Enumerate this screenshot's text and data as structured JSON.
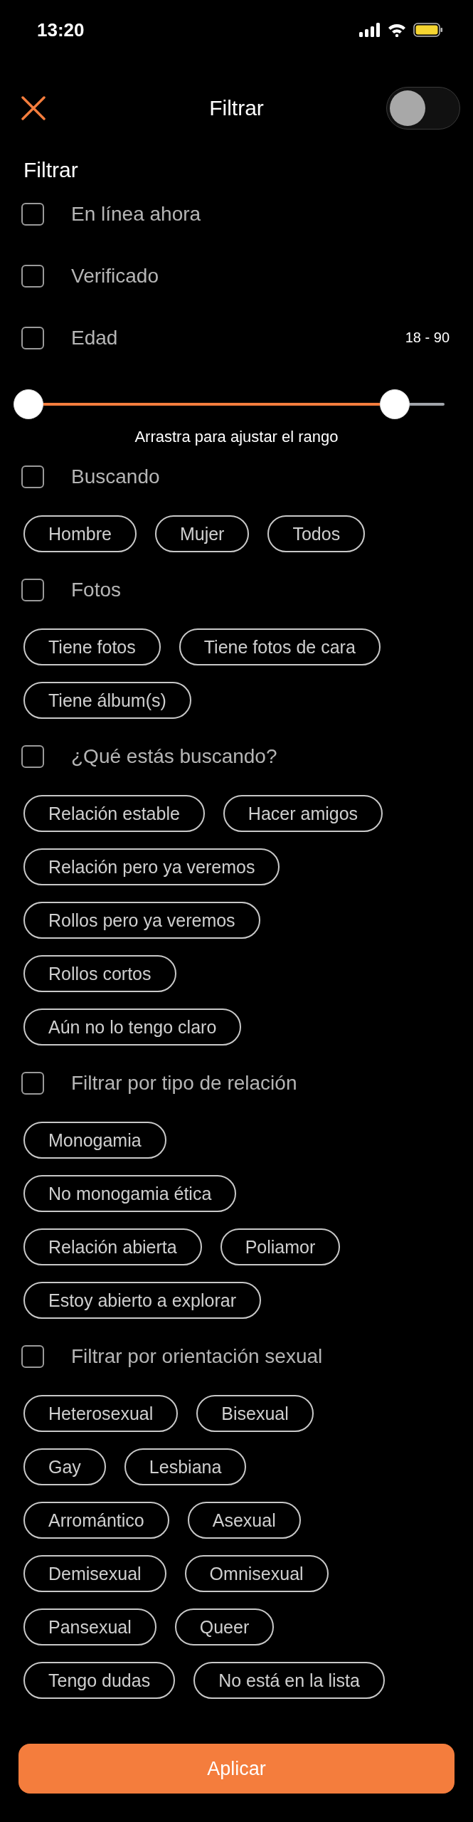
{
  "status_bar": {
    "time": "13:20"
  },
  "header": {
    "title": "Filtrar",
    "toggle_on": false
  },
  "section_title": "Filtrar",
  "groups": [
    {
      "label": "En línea ahora",
      "checked": false
    },
    {
      "label": "Verificado",
      "checked": false
    },
    {
      "label": "Edad",
      "checked": false,
      "value": "18 - 90",
      "slider": {
        "thumbs": [
          {
            "level": 0
          },
          {
            "level": 0.88
          }
        ],
        "hint": "Arrastra para ajustar el rango"
      }
    },
    {
      "label": "Buscando",
      "checked": false,
      "chip_rows": [
        [
          {
            "label": "Hombre",
            "selected": false
          },
          {
            "label": "Mujer",
            "selected": false
          },
          {
            "label": "Todos",
            "selected": false
          }
        ]
      ]
    },
    {
      "label": "Fotos",
      "checked": false,
      "chip_rows": [
        [
          {
            "label": "Tiene fotos",
            "selected": false
          },
          {
            "label": "Tiene fotos de cara",
            "selected": false
          }
        ],
        [
          {
            "label": "Tiene álbum(s)",
            "selected": false
          }
        ]
      ]
    },
    {
      "label": "¿Qué estás buscando?",
      "checked": false,
      "chip_rows": [
        [
          {
            "label": "Relación estable",
            "selected": false
          },
          {
            "label": "Hacer amigos",
            "selected": false
          }
        ],
        [
          {
            "label": "Relación pero ya veremos",
            "selected": false
          }
        ],
        [
          {
            "label": "Rollos pero ya veremos",
            "selected": false
          }
        ],
        [
          {
            "label": "Rollos cortos",
            "selected": false
          }
        ],
        [
          {
            "label": "Aún no lo tengo claro",
            "selected": false
          }
        ]
      ]
    },
    {
      "label": "Filtrar por tipo de relación",
      "checked": false,
      "chip_rows": [
        [
          {
            "label": "Monogamia",
            "selected": false
          }
        ],
        [
          {
            "label": "No monogamia ética",
            "selected": false
          }
        ],
        [
          {
            "label": "Relación abierta",
            "selected": false
          },
          {
            "label": "Poliamor",
            "selected": false
          }
        ],
        [
          {
            "label": "Estoy abierto a explorar",
            "selected": false
          }
        ]
      ]
    },
    {
      "label": "Filtrar por orientación sexual",
      "checked": false,
      "chip_rows": [
        [
          {
            "label": "Heterosexual",
            "selected": false
          },
          {
            "label": "Bisexual",
            "selected": false
          }
        ],
        [
          {
            "label": "Gay",
            "selected": false
          },
          {
            "label": "Lesbiana",
            "selected": false
          }
        ],
        [
          {
            "label": "Arromántico",
            "selected": false
          },
          {
            "label": "Asexual",
            "selected": false
          }
        ],
        [
          {
            "label": "Demisexual",
            "selected": false
          },
          {
            "label": "Omnisexual",
            "selected": false
          }
        ],
        [
          {
            "label": "Pansexual",
            "selected": false
          },
          {
            "label": "Queer",
            "selected": false
          }
        ],
        [
          {
            "label": "Tengo dudas",
            "selected": false
          },
          {
            "label": "No está en la lista",
            "selected": false
          }
        ]
      ]
    }
  ],
  "apply_button": "Aplicar"
}
